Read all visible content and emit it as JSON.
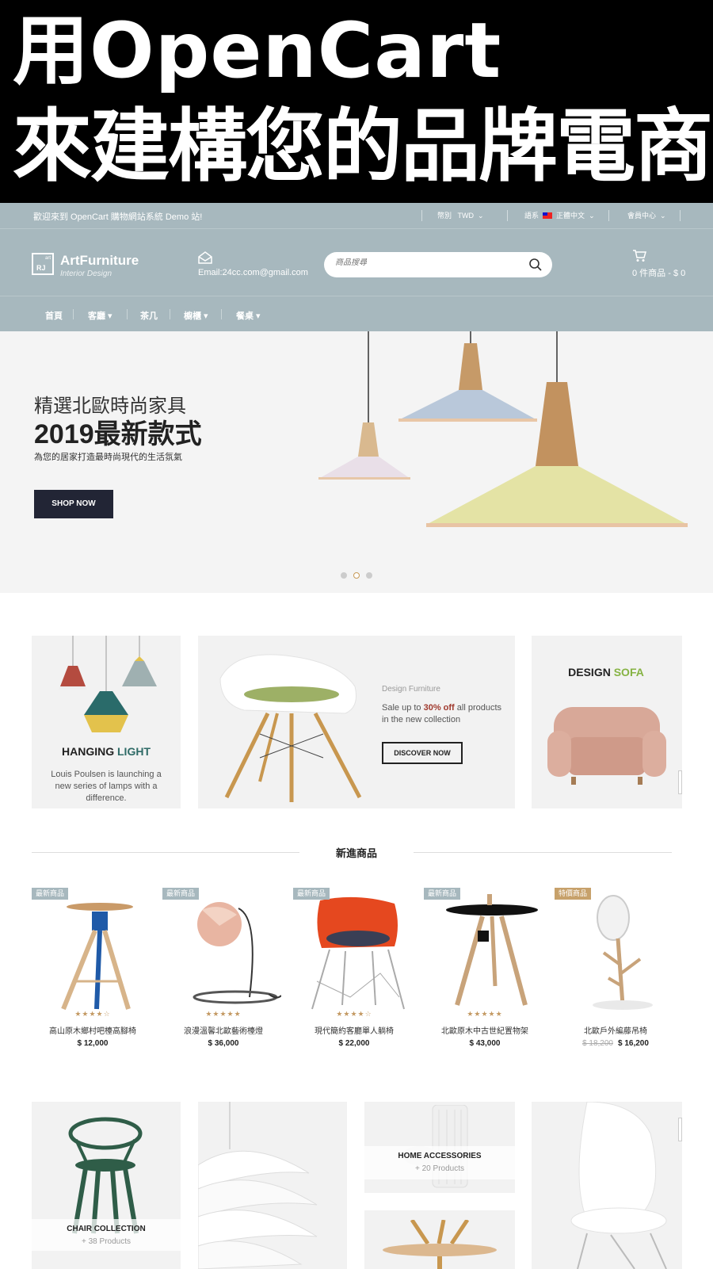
{
  "banner": {
    "line1": "用OpenCart",
    "line2": "來建構您的品牌電商"
  },
  "topbar": {
    "welcome": "歡迎來到 OpenCart 購物網站系統 Demo 站!",
    "currency_label": "幣別",
    "currency_value": "TWD",
    "language_label": "語系",
    "language_value": "正體中文",
    "account": "會員中心"
  },
  "header": {
    "logo_name": "ArtFurniture",
    "logo_sub": "Interior Design",
    "logo_mark": "RJ",
    "logo_mark_small": "art",
    "email": "Email:24cc.com@gmail.com",
    "search_placeholder": "商品搜尋",
    "cart": "0 件商品 - $ 0"
  },
  "nav": {
    "items": [
      {
        "label": "首頁"
      },
      {
        "label": "客廳 ▾"
      },
      {
        "label": "茶几"
      },
      {
        "label": "櫥櫃 ▾"
      },
      {
        "label": "餐桌 ▾"
      }
    ]
  },
  "hero": {
    "subtitle": "精選北歐時尚家具",
    "title": "2019最新款式",
    "desc": "為您的居家打造最時尚現代的生活氛氣",
    "button": "SHOP NOW"
  },
  "promos": {
    "light_title_a": "HANGING ",
    "light_title_b": "LIGHT",
    "light_desc": "Louis Poulsen is launching a new series of lamps with a difference.",
    "chair_eyebrow": "Design Furniture",
    "chair_desc_a": "Sale up to ",
    "chair_desc_b": "30% off",
    "chair_desc_c": " all products",
    "chair_desc_d": "in the new collection",
    "chair_button": "DISCOVER NOW",
    "sofa_title_a": "DESIGN ",
    "sofa_title_b": "SOFA"
  },
  "section": {
    "title": "新進商品"
  },
  "products": [
    {
      "badge": "最新商品",
      "stars": "★★★★☆",
      "name": "高山原木鄉村吧檯高腳椅",
      "price": "$ 12,000"
    },
    {
      "badge": "最新商品",
      "stars": "★★★★★",
      "name": "浪漫溫馨北歐藝術檯燈",
      "price": "$ 36,000"
    },
    {
      "badge": "最新商品",
      "stars": "★★★★☆",
      "name": "現代簡約客廳單人躺椅",
      "price": "$ 22,000"
    },
    {
      "badge": "最新商品",
      "stars": "★★★★★",
      "name": "北歐原木中古世紀置物架",
      "price": "$ 43,000"
    },
    {
      "badge": "特價商品",
      "stars": "",
      "name": "北歐戶外編藤吊椅",
      "old_price": "$ 18,200",
      "price": "$ 16,200"
    }
  ],
  "categories": {
    "chair_label": "CHAIR COLLECTION",
    "chair_count": "+ 38 Products",
    "home_label": "HOME ACCESSORIES",
    "home_count": "+ 20 Products"
  },
  "colors": {
    "header_bg": "#a7b8be",
    "dark": "#222535",
    "accent_green": "#2e6a66",
    "accent_sale": "#a03a2e",
    "accent_sofa": "#86b344",
    "badge_new": "#a7b8be",
    "badge_sale": "#c7a16b"
  }
}
